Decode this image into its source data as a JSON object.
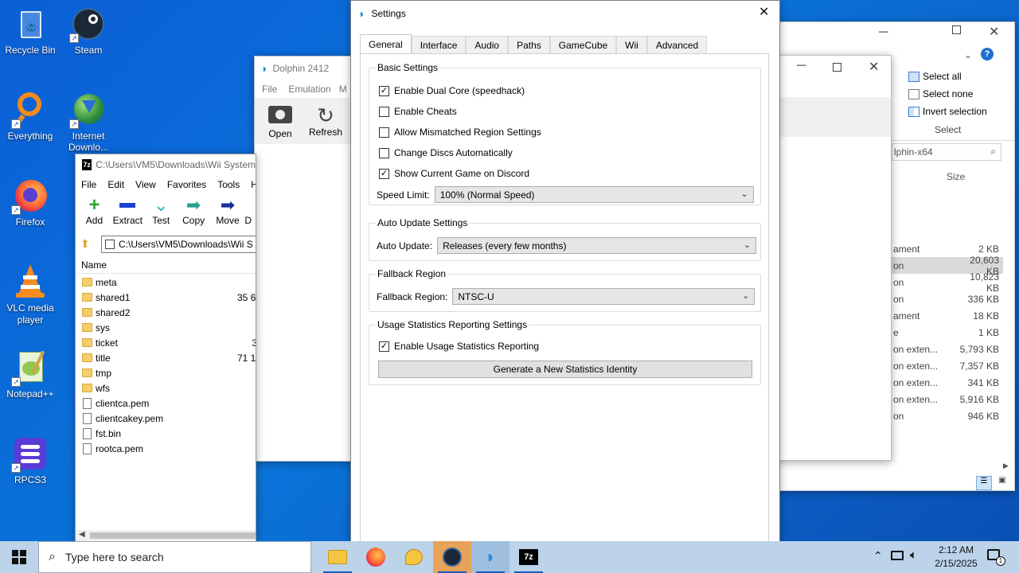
{
  "desktop": {
    "icons": [
      {
        "label": "Recycle Bin"
      },
      {
        "label": "Steam"
      },
      {
        "label": "Everything"
      },
      {
        "label": "Internet Downlo..."
      },
      {
        "label": "Firefox"
      },
      {
        "label": "VLC media player"
      },
      {
        "label": "Notepad++"
      },
      {
        "label": "RPCS3"
      }
    ]
  },
  "explorer": {
    "ribbon": {
      "select_all": "Select all",
      "select_none": "Select none",
      "invert_selection": "Invert selection",
      "group_label": "Select"
    },
    "search_text": "lphin-x64",
    "size_header": "Size",
    "rows": [
      {
        "type": "ament",
        "size": "2 KB"
      },
      {
        "type": "on",
        "size": "20,603 KB"
      },
      {
        "type": "on",
        "size": "10,823 KB"
      },
      {
        "type": "on",
        "size": "336 KB"
      },
      {
        "type": "ament",
        "size": "18 KB"
      },
      {
        "type": "e",
        "size": "1 KB"
      },
      {
        "type": "on exten...",
        "size": "5,793 KB"
      },
      {
        "type": "on exten...",
        "size": "7,357 KB"
      },
      {
        "type": "on exten...",
        "size": "341 KB"
      },
      {
        "type": "on exten...",
        "size": "5,916 KB"
      },
      {
        "type": "on",
        "size": "946 KB"
      }
    ]
  },
  "dolphin": {
    "title": "Dolphin 2412",
    "menu": {
      "file": "File",
      "emulation": "Emulation",
      "more": "M"
    },
    "toolbar": {
      "open": "Open",
      "refresh": "Refresh"
    }
  },
  "sevenzip": {
    "path_title": "C:\\Users\\VM5\\Downloads\\Wii System",
    "menu": [
      "File",
      "Edit",
      "View",
      "Favorites",
      "Tools",
      "He"
    ],
    "toolbar": [
      "Add",
      "Extract",
      "Test",
      "Copy",
      "Move",
      "D"
    ],
    "address": "C:\\Users\\VM5\\Downloads\\Wii S",
    "name_header": "Name",
    "items": [
      {
        "name": "meta",
        "kind": "folder",
        "size": ""
      },
      {
        "name": "shared1",
        "kind": "folder",
        "size": "35 6"
      },
      {
        "name": "shared2",
        "kind": "folder",
        "size": ""
      },
      {
        "name": "sys",
        "kind": "folder",
        "size": ""
      },
      {
        "name": "ticket",
        "kind": "folder",
        "size": "3"
      },
      {
        "name": "title",
        "kind": "folder",
        "size": "71 1"
      },
      {
        "name": "tmp",
        "kind": "folder",
        "size": ""
      },
      {
        "name": "wfs",
        "kind": "folder",
        "size": ""
      },
      {
        "name": "clientca.pem",
        "kind": "file",
        "size": ""
      },
      {
        "name": "clientcakey.pem",
        "kind": "file",
        "size": ""
      },
      {
        "name": "fst.bin",
        "kind": "file",
        "size": ""
      },
      {
        "name": "rootca.pem",
        "kind": "file",
        "size": ""
      }
    ]
  },
  "settings": {
    "title": "Settings",
    "tabs": [
      "General",
      "Interface",
      "Audio",
      "Paths",
      "GameCube",
      "Wii",
      "Advanced"
    ],
    "basic": {
      "title": "Basic Settings",
      "dual_core": "Enable Dual Core (speedhack)",
      "dual_core_checked": true,
      "cheats": "Enable Cheats",
      "cheats_checked": false,
      "mismatched": "Allow Mismatched Region Settings",
      "mismatched_checked": false,
      "change_discs": "Change Discs Automatically",
      "change_discs_checked": false,
      "discord": "Show Current Game on Discord",
      "discord_checked": true,
      "speed_label": "Speed Limit:",
      "speed_value": "100% (Normal Speed)"
    },
    "auto_update": {
      "title": "Auto Update Settings",
      "label": "Auto Update:",
      "value": "Releases (every few months)"
    },
    "fallback": {
      "title": "Fallback Region",
      "label": "Fallback Region:",
      "value": "NTSC-U"
    },
    "usage": {
      "title": "Usage Statistics Reporting Settings",
      "enable": "Enable Usage Statistics Reporting",
      "enable_checked": true,
      "button": "Generate a New Statistics Identity"
    }
  },
  "taskbar": {
    "search_placeholder": "Type here to search",
    "time": "2:12 AM",
    "date": "2/15/2025"
  }
}
